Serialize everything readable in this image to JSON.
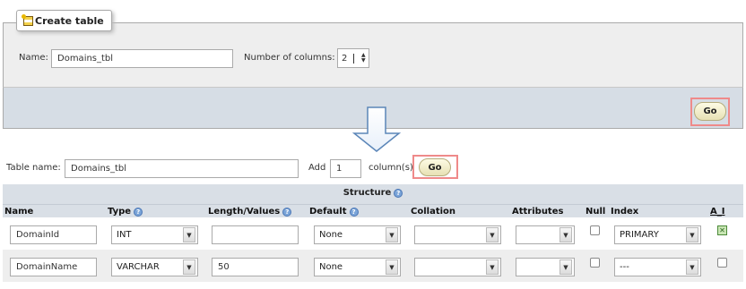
{
  "create_table": {
    "legend": "Create table",
    "name_label": "Name:",
    "name_value": "Domains_tbl",
    "columns_label": "Number of columns:",
    "columns_value": "2",
    "go_label": "Go"
  },
  "table_form": {
    "table_name_label": "Table name:",
    "table_name_value": "Domains_tbl",
    "add_label": "Add",
    "add_value": "1",
    "columns_label": "column(s)",
    "go_label": "Go"
  },
  "structure": {
    "title": "Structure",
    "headers": {
      "name": "Name",
      "type": "Type",
      "length": "Length/Values",
      "default": "Default",
      "collation": "Collation",
      "attributes": "Attributes",
      "null": "Null",
      "index": "Index",
      "ai": "A_I"
    },
    "rows": [
      {
        "name": "DomainId",
        "type": "INT",
        "length": "",
        "default": "None",
        "collation": "",
        "attributes": "",
        "null_checked": false,
        "index": "PRIMARY",
        "ai_checked": true
      },
      {
        "name": "DomainName",
        "type": "VARCHAR",
        "length": "50",
        "default": "None",
        "collation": "",
        "attributes": "",
        "null_checked": false,
        "index": "---",
        "ai_checked": false
      }
    ]
  },
  "icons": {
    "table": "table-add-icon",
    "help": "help-icon",
    "arrow": "down-arrow-icon",
    "dropdown": "dropdown-arrow-icon"
  },
  "colors": {
    "highlight": "#ef8a8a",
    "header_bg": "#d9dfe6",
    "panel_bg": "#eeeeee"
  }
}
